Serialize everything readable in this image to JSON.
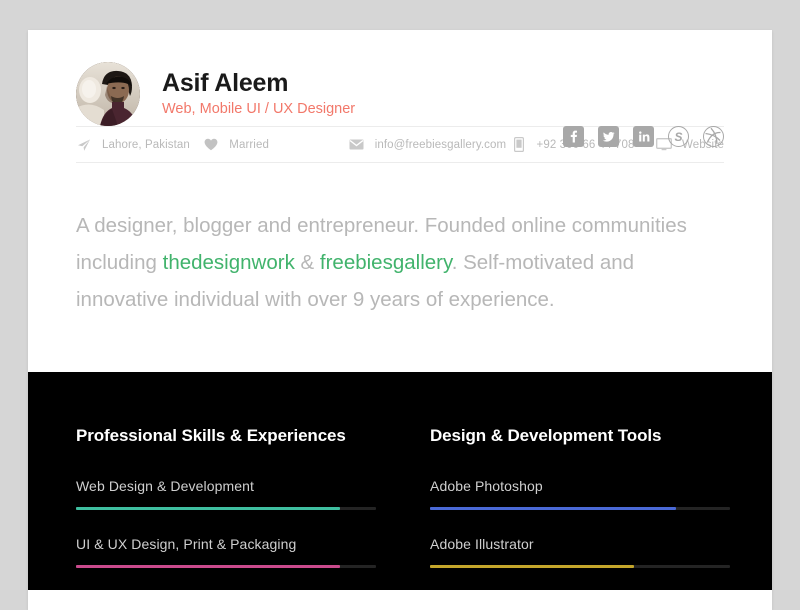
{
  "profile": {
    "name": "Asif Aleem",
    "title": "Web, Mobile UI / UX Designer",
    "avatar_alt": "avatar-photo",
    "title_color": "#f2786a"
  },
  "social": [
    {
      "name": "facebook-icon",
      "label": "Facebook"
    },
    {
      "name": "twitter-icon",
      "label": "Twitter"
    },
    {
      "name": "linkedin-icon",
      "label": "LinkedIn"
    },
    {
      "name": "skype-icon",
      "label": "Skype"
    },
    {
      "name": "dribbble-icon",
      "label": "Dribbble"
    }
  ],
  "contact": {
    "location": "Lahore, Pakistan",
    "marital_status": "Married",
    "email": "info@freebiesgallery.com",
    "phone": "+92 300 66 44 708",
    "website": "Website"
  },
  "bio": {
    "part1": "A designer, blogger and entrepreneur. Founded online communities including ",
    "link1": "thedesignwork",
    "part2": " & ",
    "link2": "freebiesgallery",
    "part3": ". Self-motivated and innovative individual with over 9 years of experience.",
    "link_color": "#41b36c"
  },
  "skills_section": {
    "left": {
      "heading": "Professional Skills & Experiences",
      "items": [
        {
          "label": "Web Design & Development",
          "percent": 88,
          "color": "#3fbfa0"
        },
        {
          "label": "UI & UX Design, Print & Packaging",
          "percent": 88,
          "color": "#c94a8c"
        }
      ]
    },
    "right": {
      "heading": "Design & Development Tools",
      "items": [
        {
          "label": "Adobe Photoshop",
          "percent": 82,
          "color": "#4a69d6"
        },
        {
          "label": "Adobe Illustrator",
          "percent": 68,
          "color": "#c4a62b"
        }
      ]
    }
  }
}
